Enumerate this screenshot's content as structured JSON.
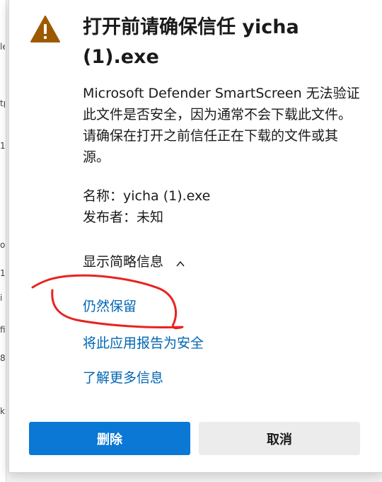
{
  "background": {
    "edge_glyphs": [
      "le",
      "tp",
      "1",
      "ob",
      "1",
      "i",
      "fi",
      "8",
      "k"
    ]
  },
  "dialog": {
    "icon": "warning-icon",
    "title": "打开前请确保信任 yicha (1).exe",
    "description": "Microsoft Defender SmartScreen 无法验证此文件是否安全，因为通常不会下载此文件。请确保在打开之前信任正在下载的文件或其源。",
    "name_line": "名称：yicha (1).exe",
    "publisher_line": "发布者：未知",
    "toggle_label": "显示简略信息",
    "links": {
      "keep_anyway": "仍然保留",
      "report_safe": "将此应用报告为安全",
      "learn_more": "了解更多信息"
    },
    "buttons": {
      "delete": "删除",
      "cancel": "取消"
    }
  },
  "colors": {
    "warning": "#9c5a00",
    "link": "#0066b4",
    "primary_button": "#0a78d4",
    "annotation": "#e8231f"
  }
}
